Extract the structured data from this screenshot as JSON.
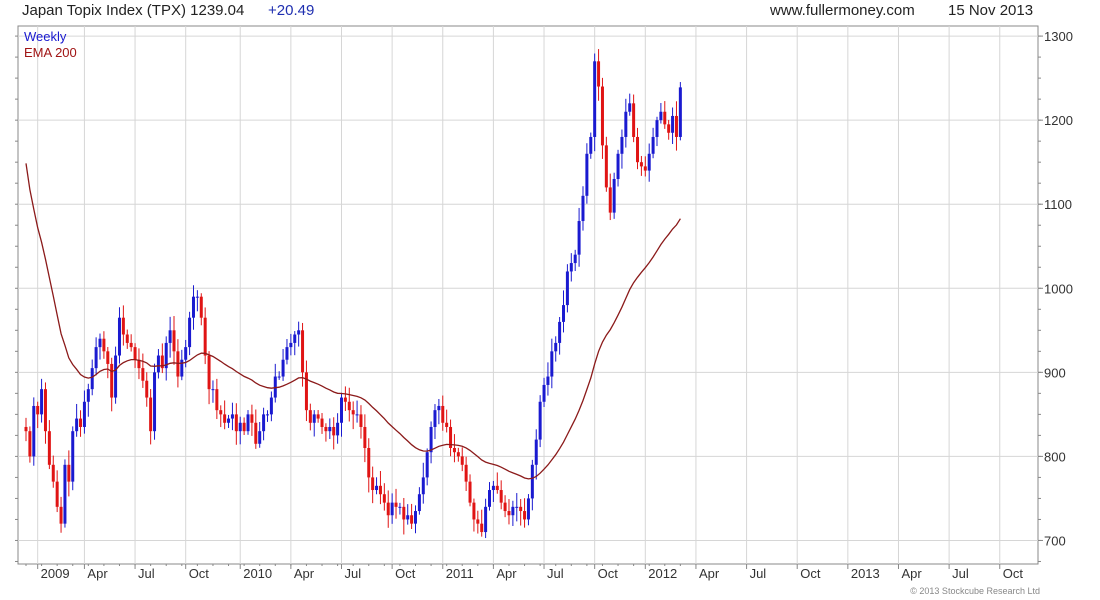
{
  "header": {
    "title": "Japan Topix Index (TPX) 1239.04",
    "change": "+20.49",
    "site": "www.fullermoney.com",
    "date": "15 Nov 2013"
  },
  "legend": {
    "weekly": "Weekly",
    "ema": "EMA 200"
  },
  "copyright": "© 2013 Stockcube Research Ltd",
  "colors": {
    "up": "#1a1ad0",
    "down": "#e01414",
    "ema": "#8b1a1a",
    "grid": "#d6d6d6",
    "frame": "#888888"
  },
  "chart_data": {
    "type": "candlestick",
    "title": "Japan Topix Index (TPX) 1239.04 +20.49",
    "subtitle": "Weekly",
    "yticks": [
      "700",
      "800",
      "900",
      "1000",
      "1100",
      "1200",
      "1300"
    ],
    "ylim": [
      672,
      1312
    ],
    "y_axis_side": "right",
    "grid": true,
    "legend_position": "top-left",
    "xticks": [
      {
        "label": "2009",
        "w": 3
      },
      {
        "label": "Apr",
        "w": 15
      },
      {
        "label": "Jul",
        "w": 28
      },
      {
        "label": "Oct",
        "w": 41
      },
      {
        "label": "2010",
        "w": 55
      },
      {
        "label": "Apr",
        "w": 68
      },
      {
        "label": "Jul",
        "w": 81
      },
      {
        "label": "Oct",
        "w": 94
      },
      {
        "label": "2011",
        "w": 107
      },
      {
        "label": "Apr",
        "w": 120
      },
      {
        "label": "Jul",
        "w": 133
      },
      {
        "label": "Oct",
        "w": 146
      },
      {
        "label": "2012",
        "w": 159
      },
      {
        "label": "Apr",
        "w": 172
      },
      {
        "label": "Jul",
        "w": 185
      },
      {
        "label": "Oct",
        "w": 198
      },
      {
        "label": "2013",
        "w": 211
      },
      {
        "label": "Apr",
        "w": 224
      },
      {
        "label": "Jul",
        "w": 237
      },
      {
        "label": "Oct",
        "w": 250
      }
    ],
    "closes": [
      830,
      800,
      860,
      850,
      880,
      830,
      790,
      770,
      740,
      720,
      790,
      770,
      830,
      845,
      835,
      865,
      880,
      905,
      930,
      940,
      925,
      910,
      870,
      920,
      965,
      945,
      935,
      930,
      915,
      905,
      890,
      870,
      830,
      900,
      920,
      905,
      935,
      950,
      925,
      895,
      915,
      930,
      965,
      990,
      990,
      965,
      920,
      880,
      880,
      855,
      850,
      840,
      845,
      850,
      830,
      840,
      830,
      850,
      840,
      815,
      830,
      850,
      850,
      870,
      895,
      895,
      915,
      930,
      935,
      945,
      950,
      900,
      855,
      840,
      850,
      845,
      835,
      830,
      835,
      825,
      840,
      870,
      865,
      855,
      850,
      850,
      835,
      810,
      775,
      760,
      765,
      755,
      745,
      730,
      745,
      740,
      740,
      725,
      730,
      720,
      735,
      755,
      775,
      805,
      835,
      855,
      860,
      840,
      835,
      810,
      805,
      800,
      790,
      770,
      745,
      725,
      720,
      710,
      740,
      760,
      765,
      760,
      745,
      735,
      730,
      740,
      740,
      735,
      725,
      750,
      790,
      820,
      865,
      885,
      895,
      925,
      935,
      960,
      980,
      1020,
      1030,
      1040,
      1080,
      1110,
      1160,
      1180,
      1270,
      1240,
      1170,
      1120,
      1090,
      1130,
      1160,
      1180,
      1210,
      1220,
      1180,
      1150,
      1145,
      1140,
      1160,
      1180,
      1200,
      1210,
      1195,
      1185,
      1205,
      1180,
      1239
    ],
    "series": [
      {
        "name": "Weekly",
        "style": "candlestick",
        "color_up": "#1a1ad0",
        "color_down": "#e01414"
      },
      {
        "name": "EMA 200",
        "style": "line",
        "color": "#8b1a1a"
      }
    ]
  }
}
